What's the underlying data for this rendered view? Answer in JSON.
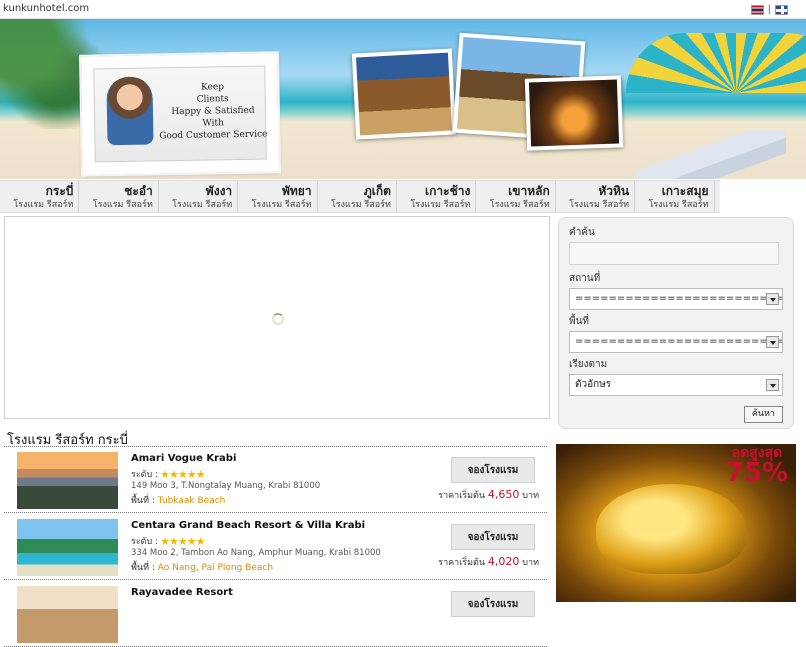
{
  "header": {
    "site_url": "kunkunhotel.com",
    "lang_sep": "|"
  },
  "banner": {
    "stamp_text": [
      "Keep",
      "Clients",
      "Happy & Satisfied",
      "With",
      "Good Customer Service"
    ]
  },
  "nav": {
    "items": [
      {
        "title": "กระบี่",
        "sub": "โรงแรม รีสอร์ท"
      },
      {
        "title": "ชะอำ",
        "sub": "โรงแรม รีสอร์ท"
      },
      {
        "title": "พังงา",
        "sub": "โรงแรม รีสอร์ท"
      },
      {
        "title": "พัทยา",
        "sub": "โรงแรม รีสอร์ท"
      },
      {
        "title": "ภูเก็ต",
        "sub": "โรงแรม รีสอร์ท"
      },
      {
        "title": "เกาะช้าง",
        "sub": "โรงแรม รีสอร์ท"
      },
      {
        "title": "เขาหลัก",
        "sub": "โรงแรม รีสอร์ท"
      },
      {
        "title": "หัวหิน",
        "sub": "โรงแรม รีสอร์ท"
      },
      {
        "title": "เกาะสมุย",
        "sub": "โรงแรม รีสอร์ท"
      }
    ]
  },
  "search": {
    "keyword_label": "คำค้น",
    "keyword_value": "",
    "place_label": "สถานที่",
    "place_value": "=========================",
    "area_label": "พื้นที่",
    "area_value": "=========================",
    "sort_label": "เรียงตาม",
    "sort_value": "ตัวอักษร",
    "button_label": "ค้นหา"
  },
  "list": {
    "title": "โรงแรม รีสอร์ท กระบี่",
    "rating_label": "ระดับ :",
    "area_label": "พื้นที่ :",
    "book_label": "จองโรงแรม",
    "price_prefix": "ราคาเริ่มต้น",
    "price_unit": "บาท",
    "hotels": [
      {
        "name": "Amari Vogue Krabi",
        "stars": "★★★★★",
        "address": "149 Moo 3, T.Nongtalay Muang, Krabi 81000",
        "area": "Tubkaak Beach",
        "price": "4,650"
      },
      {
        "name": "Centara Grand Beach Resort & Villa Krabi",
        "stars": "★★★★★",
        "address": "334 Moo 2, Tambon Ao Nang, Amphur Muang, Krabi 81000",
        "area": "Ao Nang, Pai Plong Beach",
        "price": "4,020"
      },
      {
        "name": "Rayavadee Resort",
        "stars": "★★★★★",
        "address": "",
        "area": "",
        "price": ""
      }
    ]
  },
  "ad": {
    "top": "ลดสูงสุด",
    "percent": "75%"
  },
  "colors": {
    "accent_red": "#c8102e",
    "area_orange": "#e08a00",
    "star_gold": "#f5b800"
  }
}
